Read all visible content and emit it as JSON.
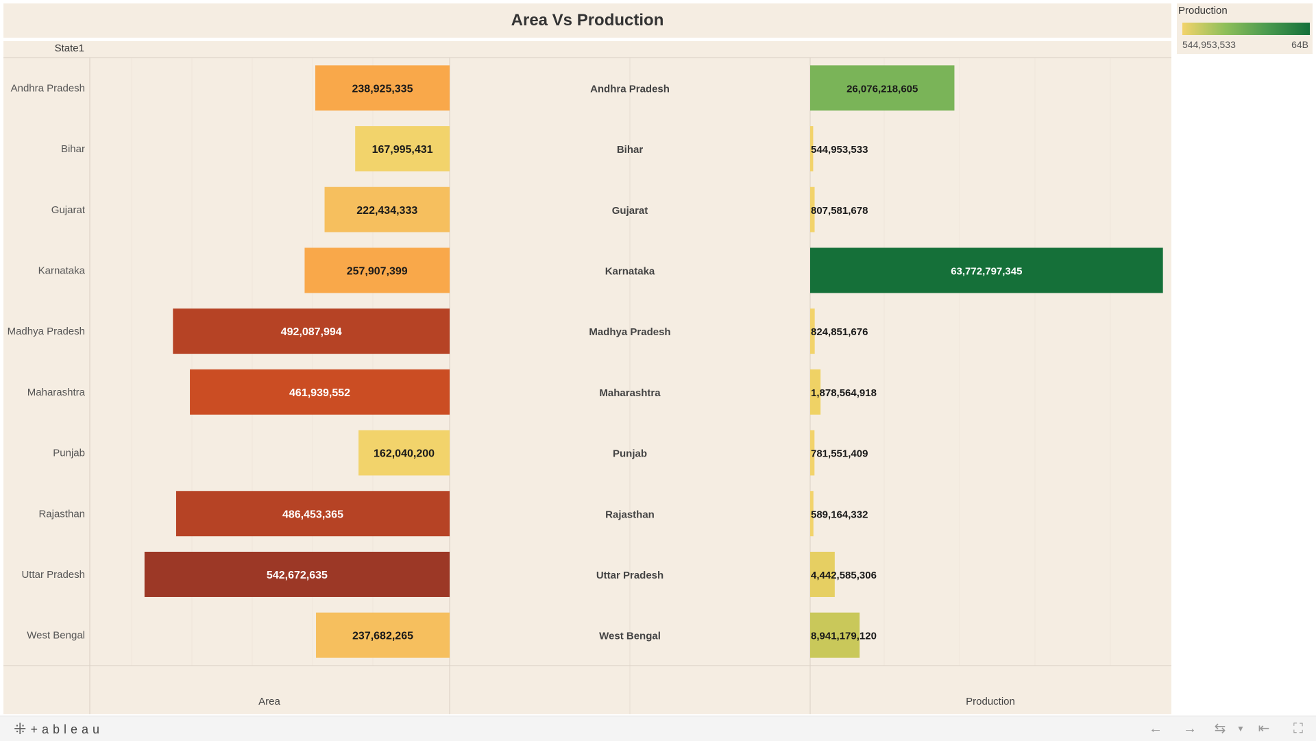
{
  "chart_data": {
    "type": "bar",
    "title": "Area Vs Production",
    "row_header": "State1",
    "categories": [
      "Andhra Pradesh",
      "Bihar",
      "Gujarat",
      "Karnataka",
      "Madhya Pradesh",
      "Maharashtra",
      "Punjab",
      "Rajasthan",
      "Uttar Pradesh",
      "West Bengal"
    ],
    "series": [
      {
        "name": "Area",
        "values": [
          238925335,
          167995431,
          222434333,
          257907399,
          492087994,
          461939552,
          162040200,
          486453365,
          542672635,
          237682265
        ],
        "labels": [
          "238,925,335",
          "167,995,431",
          "222,434,333",
          "257,907,399",
          "492,087,994",
          "461,939,552",
          "162,040,200",
          "486,453,365",
          "542,672,635",
          "237,682,265"
        ],
        "colors": [
          "#f9a84a",
          "#f2d36b",
          "#f6bf5e",
          "#f9a84a",
          "#b64325",
          "#cb4d23",
          "#f2d36b",
          "#b64325",
          "#9c3826",
          "#f6bf5e"
        ]
      },
      {
        "name": "Production",
        "values": [
          26076218605,
          544953533,
          807581678,
          63772797345,
          824851676,
          1878564918,
          781551409,
          589164332,
          4442585306,
          8941179120
        ],
        "labels": [
          "26,076,218,605",
          "544,953,533",
          "807,581,678",
          "63,772,797,345",
          "824,851,676",
          "1,878,564,918",
          "781,551,409",
          "589,164,332",
          "4,442,585,306",
          "8,941,179,120"
        ],
        "colors": [
          "#7ab458",
          "#f2d36b",
          "#f2d36b",
          "#157039",
          "#f2d36b",
          "#efd265",
          "#f2d36b",
          "#f2d36b",
          "#e6cf62",
          "#c9c85a"
        ]
      }
    ],
    "area_axis_max": 640000000,
    "production_axis_max": 65300000000,
    "legend": {
      "title": "Production",
      "min_label": "544,953,533",
      "max_label": "64B",
      "placement": "top-right"
    }
  },
  "brand": "+ableau",
  "toolbar_icons": [
    "back-icon",
    "forward-icon",
    "redo-icon",
    "dropdown-icon",
    "reset-icon",
    "fullscreen-icon"
  ]
}
